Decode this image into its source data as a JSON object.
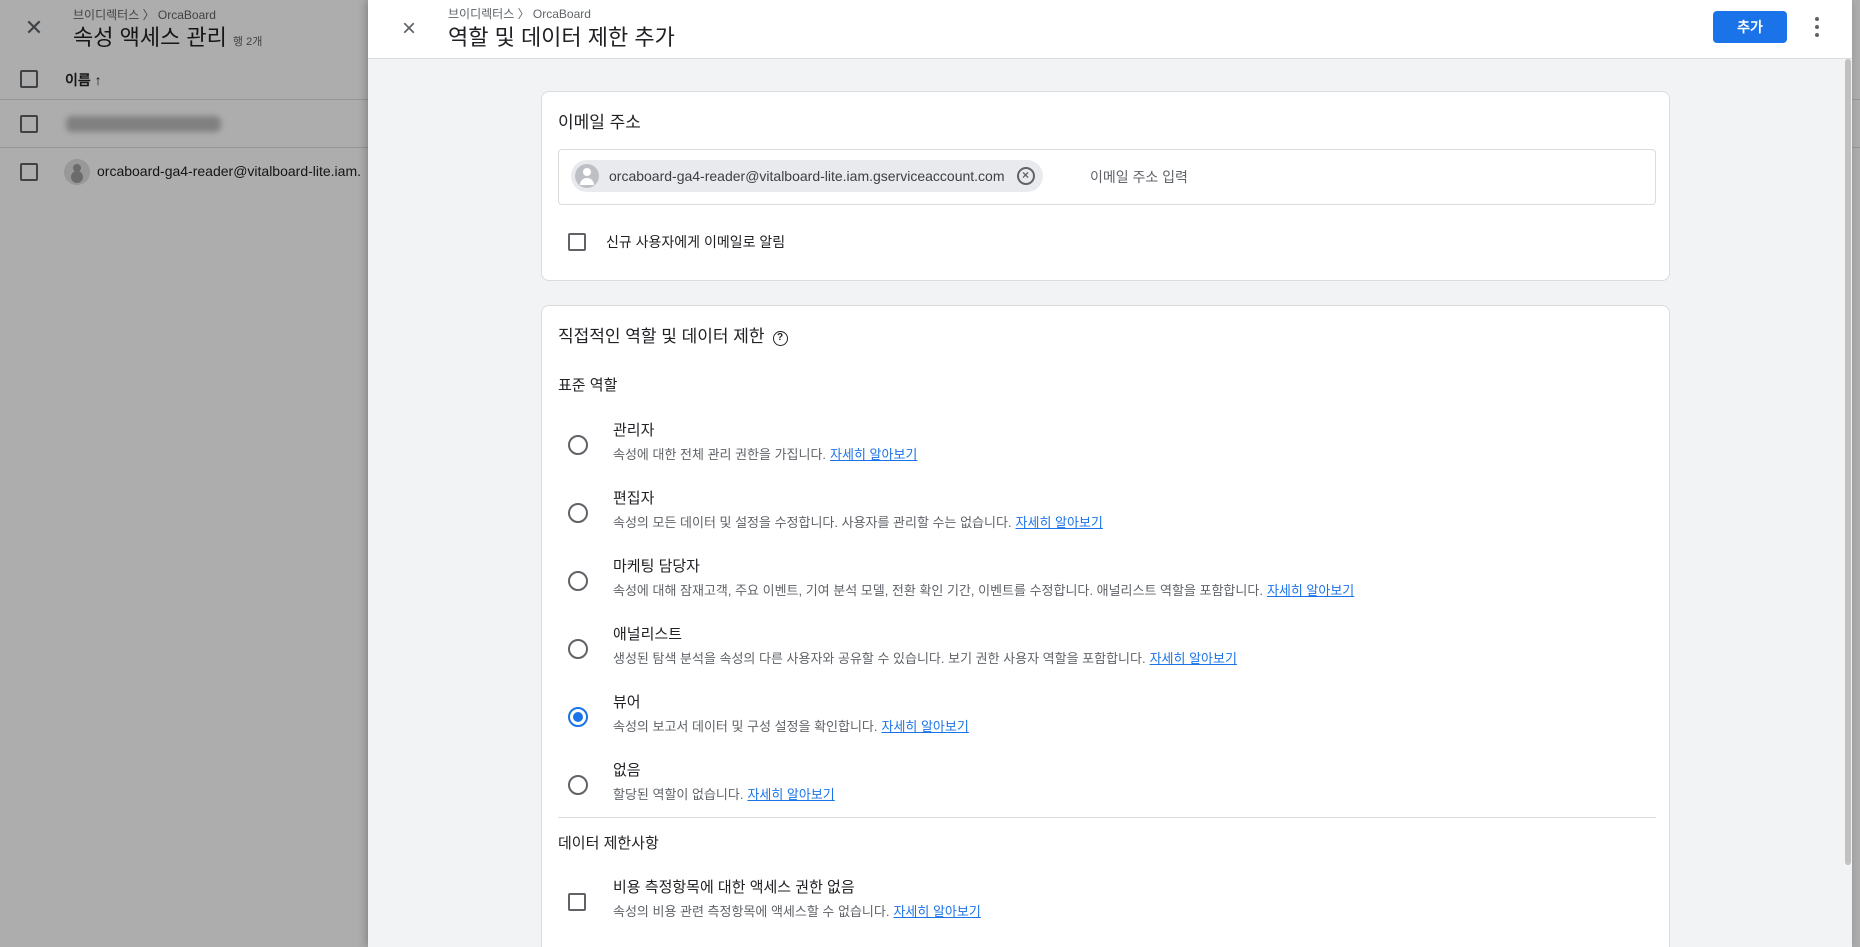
{
  "background": {
    "breadcrumb": "브이디렉터스 〉 OrcaBoard",
    "title": "속성 액세스 관리",
    "row_count": "행 2개",
    "column_name": "이름 ↑",
    "user_email": "orcaboard-ga4-reader@vitalboard-lite.iam."
  },
  "drawer": {
    "breadcrumb": "브이디렉터스 〉 OrcaBoard",
    "title": "역할 및 데이터 제한 추가",
    "close_icon": "×",
    "add_label": "추가"
  },
  "email_section": {
    "title": "이메일 주소",
    "chip_email": "orcaboard-ga4-reader@vitalboard-lite.iam.gserviceaccount.com",
    "placeholder": "이메일 주소 입력",
    "notify_label": "신규 사용자에게 이메일로 알림",
    "notify_checked": false
  },
  "roles_section": {
    "title": "직접적인 역할 및 데이터 제한",
    "help_icon": "?",
    "standard_roles_label": "표준 역할",
    "learn_more": "자세히 알아보기",
    "selected_role": "뷰어",
    "roles": [
      {
        "name": "관리자",
        "desc": "속성에 대한 전체 관리 권한을 가집니다."
      },
      {
        "name": "편집자",
        "desc": "속성의 모든 데이터 및 설정을 수정합니다. 사용자를 관리할 수는 없습니다."
      },
      {
        "name": "마케팅 담당자",
        "desc": "속성에 대해 잠재고객, 주요 이벤트, 기여 분석 모델, 전환 확인 기간, 이벤트를 수정합니다. 애널리스트 역할을 포함합니다."
      },
      {
        "name": "애널리스트",
        "desc": "생성된 탐색 분석을 속성의 다른 사용자와 공유할 수 있습니다. 보기 권한 사용자 역할을 포함합니다."
      },
      {
        "name": "뷰어",
        "desc": "속성의 보고서 데이터 및 구성 설정을 확인합니다."
      },
      {
        "name": "없음",
        "desc": "할당된 역할이 없습니다."
      }
    ],
    "data_restrictions_label": "데이터 제한사항",
    "restrictions": [
      {
        "name": "비용 측정항목에 대한 액세스 권한 없음",
        "desc": "속성의 비용 관련 측정항목에 액세스할 수 없습니다.",
        "checked": false
      }
    ]
  },
  "colors": {
    "accent": "#1a73e8",
    "scrim": "rgba(0,0,0,0.32)"
  }
}
